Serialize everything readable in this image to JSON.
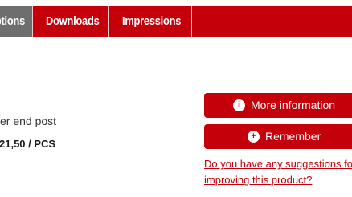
{
  "tabs": {
    "active_label": "Descriptions",
    "downloads_label": "Downloads",
    "impressions_label": "Impressions"
  },
  "product": {
    "description_fragment": "er end post",
    "price_fragment": "21,50 / PCS"
  },
  "actions": {
    "more_info_label": "More information",
    "more_info_icon": "i",
    "remember_label": "Remember",
    "remember_icon": "+",
    "suggestion_line1": "Do you have any suggestions fo",
    "suggestion_line2": "improving this product?"
  },
  "colors": {
    "brand_red": "#c4000b",
    "active_tab_gray": "#6e6e6e"
  }
}
